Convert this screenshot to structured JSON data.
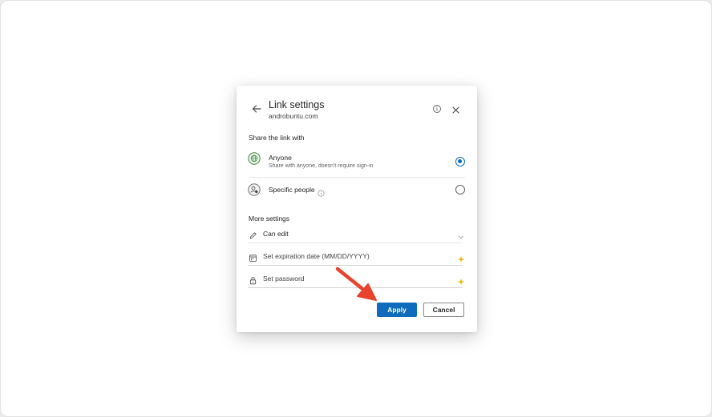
{
  "dialog": {
    "title": "Link settings",
    "subtitle": "androbuntu.com",
    "back_icon": "arrow-left-icon",
    "info_icon": "info-icon",
    "close_icon": "close-icon"
  },
  "share": {
    "heading": "Share the link with",
    "options": [
      {
        "title": "Anyone",
        "description": "Share with anyone, doesn't require sign-in",
        "icon": "globe-icon",
        "selected": true
      },
      {
        "title": "Specific people",
        "description": "",
        "icon": "people-icon",
        "info_icon": "info-icon",
        "selected": false
      }
    ]
  },
  "more_settings": {
    "heading": "More settings",
    "permission": {
      "value": "Can edit",
      "icon": "pencil-icon",
      "trail_icon": "chevron-down-icon"
    },
    "expiration": {
      "placeholder": "Set expiration date (MM/DD/YYYY)",
      "icon": "calendar-icon",
      "trail_icon": "premium-sparkle-icon"
    },
    "password": {
      "placeholder": "Set password",
      "icon": "lock-icon",
      "trail_icon": "premium-sparkle-icon"
    }
  },
  "footer": {
    "apply_label": "Apply",
    "cancel_label": "Cancel"
  },
  "colors": {
    "accent": "#0f6cbd",
    "globe_green": "#3f8c3f",
    "premium_star": "#f2b400",
    "annotation_arrow": "#e8432d"
  }
}
